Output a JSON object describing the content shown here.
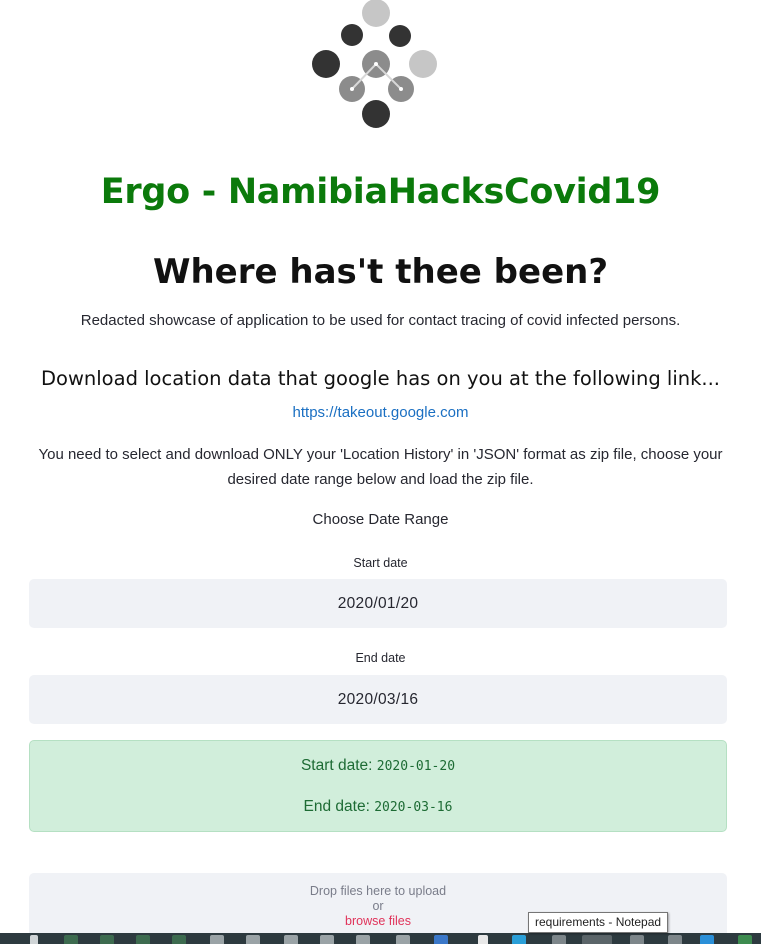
{
  "app": {
    "title": "Ergo - NamibiaHacksCovid19",
    "heading": "Where has't thee been?",
    "subtitle": "Redacted showcase of application to be used for contact tracing of covid infected persons."
  },
  "download": {
    "heading": "Download location data that google has on you at the following link...",
    "link": "https://takeout.google.com",
    "instructions": "You need to select and download ONLY your 'Location History' in 'JSON' format as zip file, choose your desired date range below and load the zip file."
  },
  "date_range": {
    "label": "Choose Date Range",
    "start_label": "Start date",
    "start_value": "2020/01/20",
    "end_label": "End date",
    "end_value": "2020/03/16"
  },
  "summary": {
    "start_prefix": "Start date:",
    "start_value": "2020-01-20",
    "end_prefix": "End date:",
    "end_value": "2020-03-16"
  },
  "uploader": {
    "drop_text": "Drop files here to upload",
    "or_text": "or",
    "browse_text": "browse files"
  },
  "tooltip": {
    "text": "requirements - Notepad"
  },
  "colors": {
    "title_green": "#0b7a0b",
    "link_blue": "#1a6fc2",
    "success_bg": "#d1eedb",
    "input_bg": "#f0f2f6",
    "browse_red": "#e0335a"
  },
  "icons": {
    "logo": "molecule-logo-icon"
  }
}
